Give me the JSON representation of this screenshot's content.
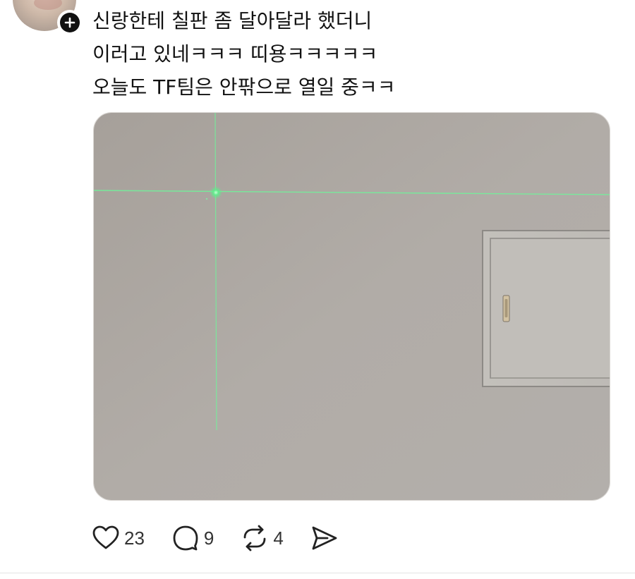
{
  "post": {
    "lines": [
      "신랑한테 칠판 좀 달아달라 했더니",
      "이러고 있네ㅋㅋㅋ 띠용ㅋㅋㅋㅋㅋ",
      "오늘도 TF팀은 안팎으로 열일 중ㅋㅋ"
    ]
  },
  "icons": {
    "follow": "plus-icon",
    "like": "heart-icon",
    "reply": "speech-bubble-icon",
    "repost": "repost-icon",
    "share": "send-icon"
  },
  "actions": {
    "like_count": "23",
    "reply_count": "9",
    "repost_count": "4"
  },
  "colors": {
    "laser_green": "#5cf08a",
    "wall_gray": "#b5b0aa",
    "text": "#111111"
  }
}
